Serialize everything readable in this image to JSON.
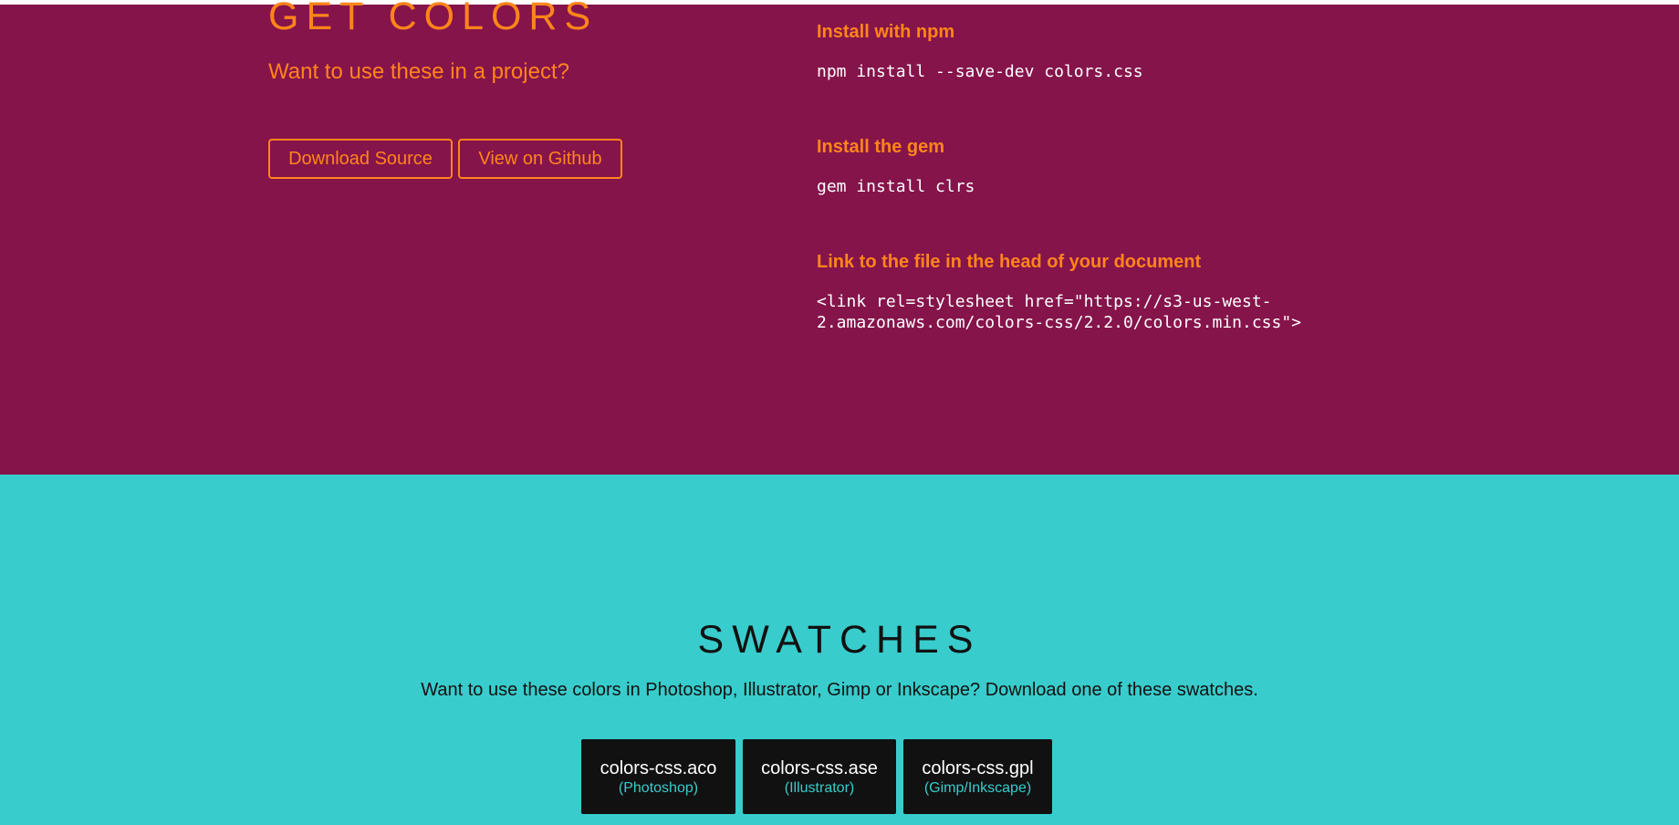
{
  "colors": {
    "maroon": "#85144b",
    "orange": "#ff851b",
    "teal": "#39cccc",
    "black": "#111111",
    "white": "#ffffff"
  },
  "get_colors": {
    "title": "GET COLORS",
    "subtitle": "Want to use these in a project?",
    "buttons": [
      {
        "label": "Download Source"
      },
      {
        "label": "View on Github"
      }
    ],
    "install": [
      {
        "heading": "Install with npm",
        "code": "npm install --save-dev colors.css"
      },
      {
        "heading": "Install the gem",
        "code": "gem install clrs"
      },
      {
        "heading": "Link to the file in the head of your document",
        "code": "<link rel=stylesheet href=\"https://s3-us-west-\n2.amazonaws.com/colors-css/2.2.0/colors.min.css\">"
      }
    ]
  },
  "swatches": {
    "title": "SWATCHES",
    "description": "Want to use these colors in Photoshop, Illustrator, Gimp or Inkscape? Download one of these swatches.",
    "buttons": [
      {
        "file": "colors-css.aco",
        "app": "(Photoshop)"
      },
      {
        "file": "colors-css.ase",
        "app": "(Illustrator)"
      },
      {
        "file": "colors-css.gpl",
        "app": "(Gimp/Inkscape)"
      }
    ]
  }
}
